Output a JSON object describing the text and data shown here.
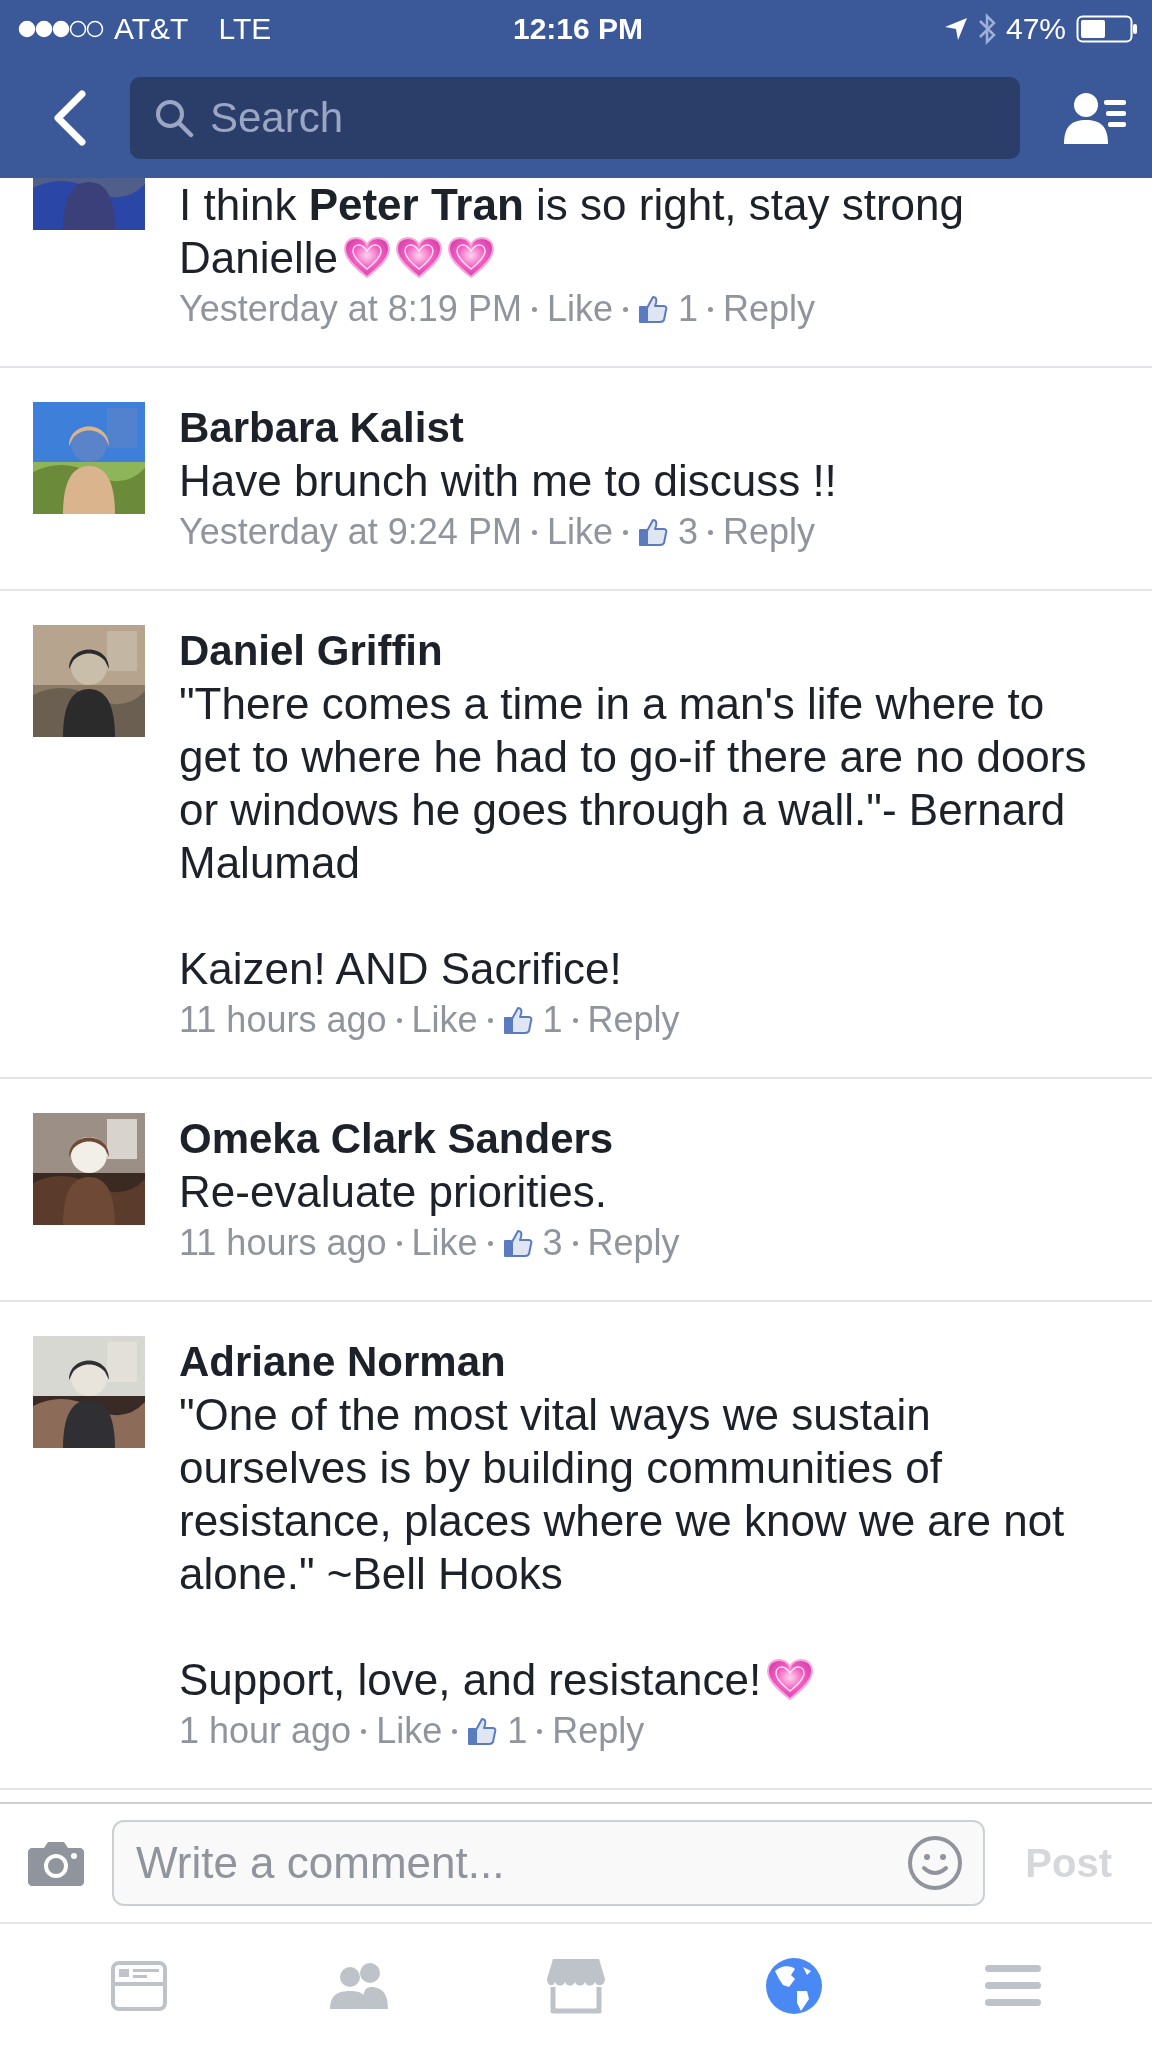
{
  "status_bar": {
    "carrier": "AT&T",
    "network": "LTE",
    "time": "12:16 PM",
    "battery": "47%"
  },
  "nav_bar": {
    "search": {
      "placeholder": "Search"
    }
  },
  "comments": [
    {
      "paragraphs": [
        {
          "text": "I think **Peter Tran** is so right, stay strong Danielle",
          "emoji": [
            {
              "kind": "heart"
            },
            {
              "kind": "heart"
            },
            {
              "kind": "heart"
            }
          ]
        }
      ],
      "meta": {
        "time": "Yesterday at 8:19 PM",
        "like": "Like",
        "likes": "1",
        "reply": "Reply"
      }
    },
    {
      "name": "Barbara Kalist",
      "paragraphs": [
        {
          "text": "Have brunch with me to discuss !!"
        }
      ],
      "meta": {
        "time": "Yesterday at 9:24 PM",
        "like": "Like",
        "likes": "3",
        "reply": "Reply"
      }
    },
    {
      "name": "Daniel Griffin",
      "paragraphs": [
        {
          "text": "\"There comes a time in a man's life where to get to where he had to go-if there are no doors or windows he goes through a wall.\"- Bernard Malumad"
        },
        {
          "text": "Kaizen! AND Sacrifice!"
        }
      ],
      "meta": {
        "time": "11 hours ago",
        "like": "Like",
        "likes": "1",
        "reply": "Reply"
      }
    },
    {
      "name": "Omeka Clark Sanders",
      "paragraphs": [
        {
          "text": "Re-evaluate priorities."
        }
      ],
      "meta": {
        "time": "11 hours ago",
        "like": "Like",
        "likes": "3",
        "reply": "Reply"
      }
    },
    {
      "name": "Adriane Norman",
      "paragraphs": [
        {
          "text": "\"One of the most vital ways we sustain ourselves is by building communities of resistance, places where we know we are not alone.\" ~Bell Hooks"
        },
        {
          "text": "Support, love, and resistance!",
          "emoji": [
            {
              "kind": "heart"
            }
          ]
        }
      ],
      "meta": {
        "time": "1 hour ago",
        "like": "Like",
        "likes": "1",
        "reply": "Reply"
      }
    }
  ],
  "comment_bar": {
    "placeholder": "Write a comment...",
    "post": "Post"
  },
  "tab_bar": [
    {
      "kind": "news",
      "selected": false
    },
    {
      "kind": "friends",
      "selected": false
    },
    {
      "kind": "marketplace",
      "selected": false
    },
    {
      "kind": "globe",
      "selected": true
    },
    {
      "kind": "menu",
      "selected": false
    }
  ]
}
